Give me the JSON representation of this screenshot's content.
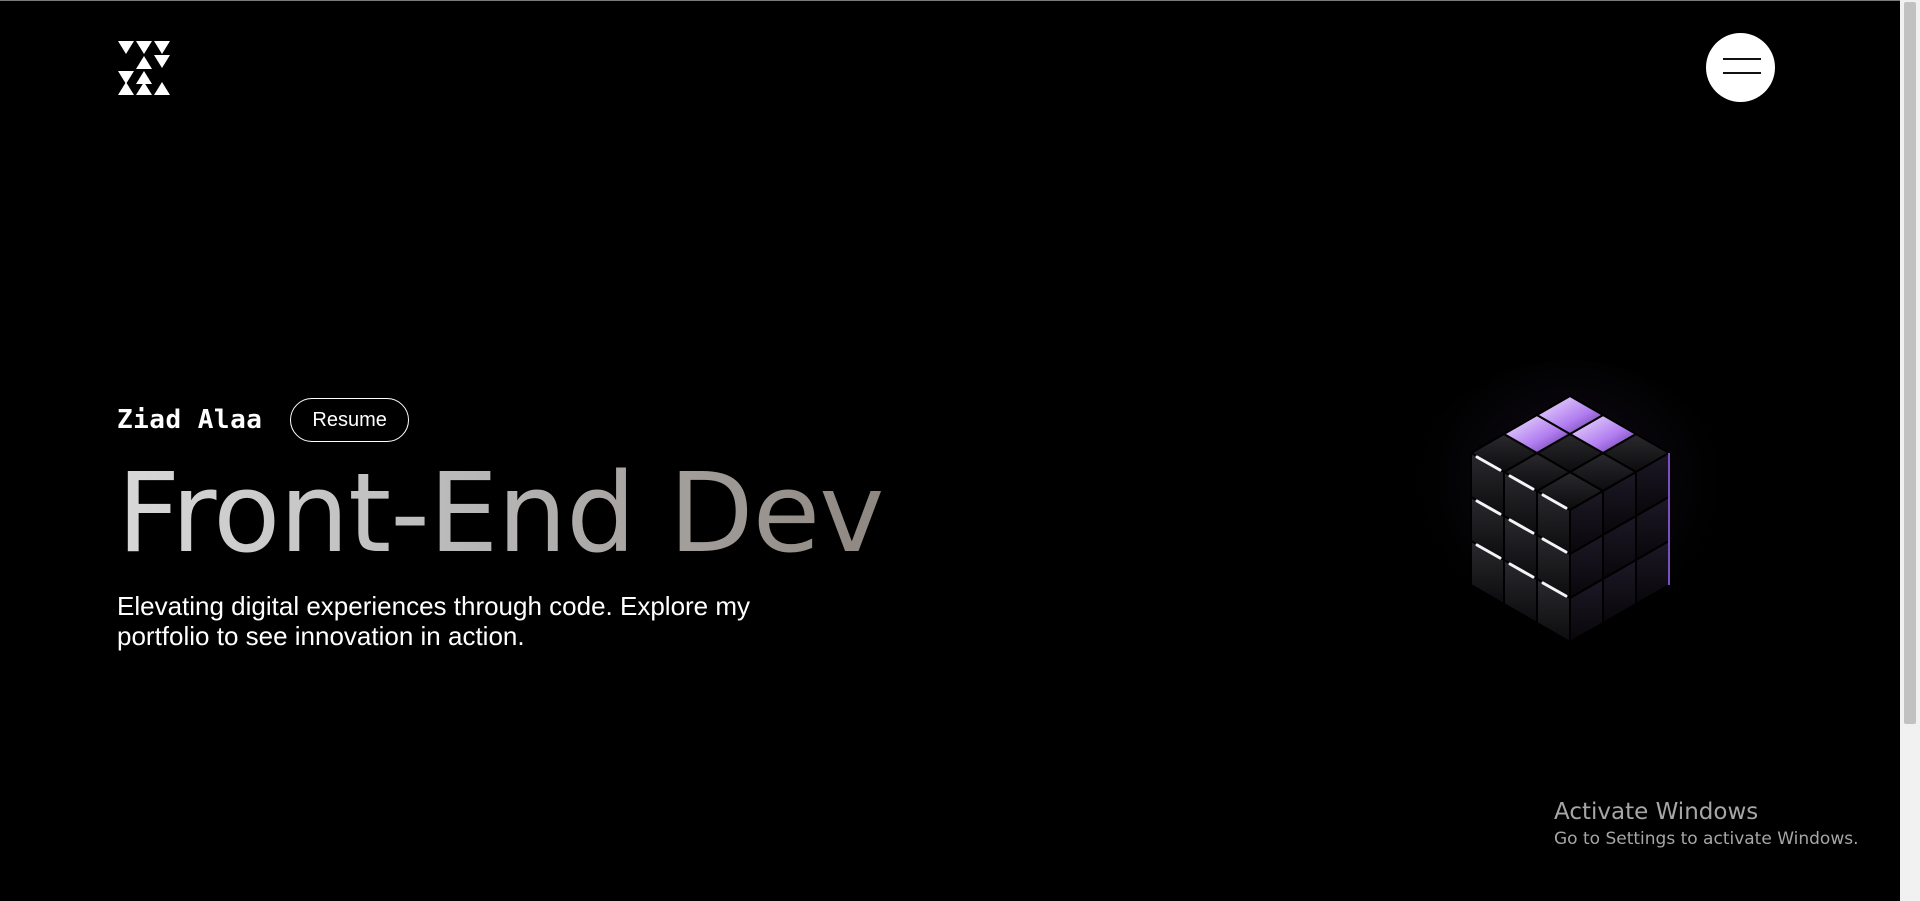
{
  "header": {
    "logo_icon": "triangle-z-logo-icon",
    "menu_icon": "hamburger-menu-icon"
  },
  "hero": {
    "name": "Ziad Alaa",
    "resume_label": "Resume",
    "headline": "Front-End Dev",
    "tagline": "Elevating digital experiences through code. Explore my portfolio to see innovation in action."
  },
  "visual": {
    "cube_icon": "rubiks-cube-3d-render",
    "accent_color": "#b07cf0"
  },
  "overlay": {
    "activate_title": "Activate Windows",
    "activate_subtitle": "Go to Settings to activate Windows."
  }
}
